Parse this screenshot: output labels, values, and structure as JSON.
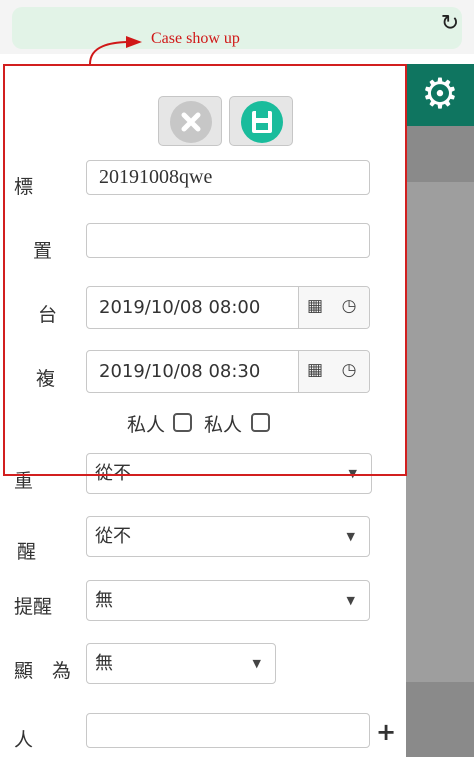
{
  "browser": {
    "reload_icon": "reload-icon"
  },
  "annotation": {
    "text": "Case show up",
    "color": "#d01818"
  },
  "appbar": {
    "settings_icon": "gear-icon",
    "color": "#0f7560"
  },
  "actions": {
    "cancel_icon": "close-icon",
    "cancel_color": "#c7c7c7",
    "save_icon": "save-icon",
    "save_color": "#1abc9c"
  },
  "form": {
    "title_label": "標",
    "title_value": "20191008qwe",
    "location_label": "置",
    "location_value": "",
    "start_label": "台",
    "start_value": "2019/10/08 08:00",
    "end_label": "複",
    "end_value": "2019/10/08 08:30",
    "private1_label": "私人",
    "private2_label": "私人",
    "repeat_label": "重",
    "repeat_value": "從不",
    "remind_label": "醒",
    "remind_value": "從不",
    "remind2_label": "提醒",
    "remind2_value": "無",
    "show_as_label": "顯　為",
    "show_as_value": "無",
    "person_label": "人",
    "person_value": ""
  }
}
